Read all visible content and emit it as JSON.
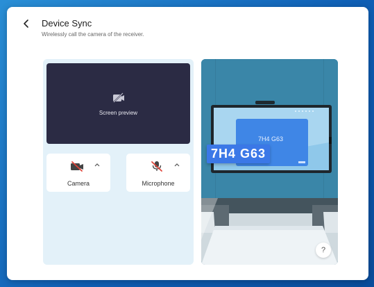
{
  "header": {
    "title": "Device Sync",
    "subtitle": "Wirelessly call the camera of the receiver."
  },
  "preview": {
    "label": "Screen preview",
    "icon": "camera-off-icon"
  },
  "controls": [
    {
      "label": "Camera",
      "icon": "camera-off-icon",
      "state": "off"
    },
    {
      "label": "Microphone",
      "icon": "microphone-off-icon",
      "state": "off"
    }
  ],
  "illustration": {
    "code_badge": "7H4 G63",
    "screen_code": "7H4 G63"
  },
  "help": {
    "label": "?"
  },
  "colors": {
    "accent": "#3b78e7",
    "off_red": "#e0453a",
    "panel_bg": "#e3f1f9",
    "preview_bg": "#2b2b44"
  }
}
